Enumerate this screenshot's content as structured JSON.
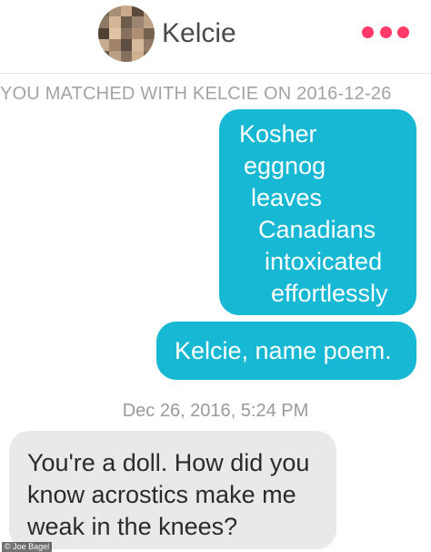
{
  "header": {
    "contact_name": "Kelcie",
    "more_icon": "three-dots-icon",
    "accent_color": "#ff3a68"
  },
  "match_notice": "YOU MATCHED WITH KELCIE ON 2016-12-26",
  "messages": [
    {
      "sender": "me",
      "lines": [
        "Kosher",
        "eggnog",
        "leaves",
        "Canadians",
        "intoxicated",
        "effortlessly"
      ]
    },
    {
      "sender": "me",
      "text": "Kelcie, name poem."
    },
    {
      "sender": "them",
      "text": "You're a doll. How did you know acrostics make me weak in the knees?"
    }
  ],
  "timestamp": "Dec 26, 2016, 5:24 PM",
  "photo_credit": "© Joe Bagel",
  "colors": {
    "outgoing_bubble": "#17b8d3",
    "incoming_bubble": "#e9e9ec"
  }
}
